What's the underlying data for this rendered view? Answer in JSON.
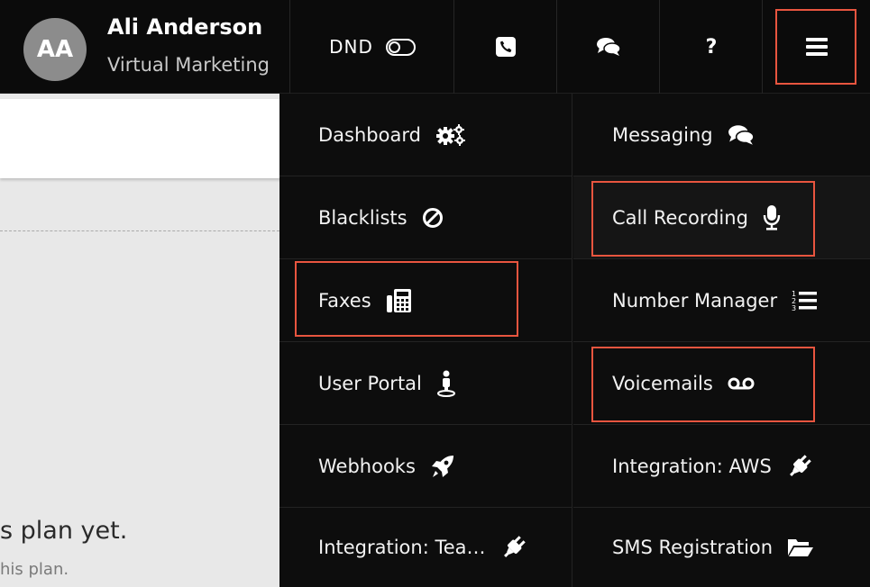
{
  "user": {
    "initials": "AA",
    "name": "Ali Anderson",
    "company": "Virtual Marketing"
  },
  "topbar": {
    "dnd_label": "DND",
    "dnd_icon": "toggle-off-icon",
    "phone_icon": "phone-icon",
    "chat_icon": "chat-icon",
    "help_label": "?",
    "menu_icon": "hamburger-menu-icon"
  },
  "menu": {
    "left": [
      {
        "label": "Dashboard",
        "icon": "gears-icon"
      },
      {
        "label": "Blacklists",
        "icon": "ban-icon"
      },
      {
        "label": "Faxes",
        "icon": "fax-icon"
      },
      {
        "label": "User Portal",
        "icon": "user-pin-icon"
      },
      {
        "label": "Webhooks",
        "icon": "rocket-icon"
      },
      {
        "label": "Integration: Tea…",
        "icon": "plug-icon"
      }
    ],
    "right": [
      {
        "label": "Messaging",
        "icon": "chat-icon"
      },
      {
        "label": "Call Recording",
        "icon": "microphone-icon"
      },
      {
        "label": "Number Manager",
        "icon": "numbered-list-icon"
      },
      {
        "label": "Voicemails",
        "icon": "voicemail-icon"
      },
      {
        "label": "Integration: AWS",
        "icon": "plug-icon"
      },
      {
        "label": "SMS Registration",
        "icon": "folder-open-icon"
      }
    ]
  },
  "background": {
    "line1": "s plan yet.",
    "line2": "his plan."
  },
  "colors": {
    "highlight": "#e8553f",
    "menu_bg": "#0d0d0d",
    "avatar_bg": "#8c8c8c"
  }
}
